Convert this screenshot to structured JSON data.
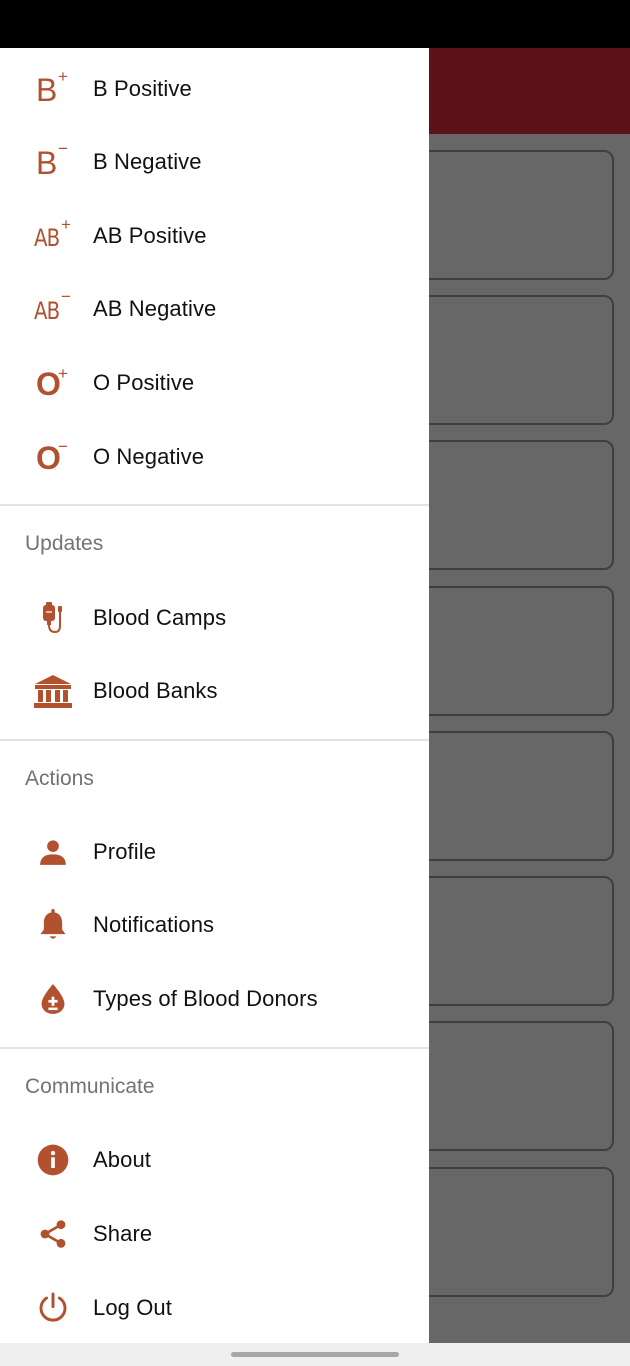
{
  "drawer": {
    "blood_groups": [
      {
        "letters": "B",
        "sign": "+",
        "label": "B Positive",
        "icon": "b-positive-icon"
      },
      {
        "letters": "B",
        "sign": "−",
        "label": "B Negative",
        "icon": "b-negative-icon"
      },
      {
        "letters": "AB",
        "sign": "+",
        "label": "AB Positive",
        "icon": "ab-positive-icon"
      },
      {
        "letters": "AB",
        "sign": "−",
        "label": "AB Negative",
        "icon": "ab-negative-icon"
      },
      {
        "letters": "O",
        "sign": "+",
        "label": "O Positive",
        "icon": "o-positive-icon"
      },
      {
        "letters": "O",
        "sign": "−",
        "label": "O Negative",
        "icon": "o-negative-icon"
      }
    ],
    "updates": {
      "header": "Updates",
      "items": [
        {
          "label": "Blood Camps",
          "icon": "blood-bag-icon"
        },
        {
          "label": "Blood Banks",
          "icon": "bank-building-icon"
        }
      ]
    },
    "actions": {
      "header": "Actions",
      "items": [
        {
          "label": "Profile",
          "icon": "person-icon"
        },
        {
          "label": "Notifications",
          "icon": "bell-icon"
        },
        {
          "label": "Types of Blood Donors",
          "icon": "blood-drop-icon"
        }
      ]
    },
    "communicate": {
      "header": "Communicate",
      "items": [
        {
          "label": "About",
          "icon": "info-icon"
        },
        {
          "label": "Share",
          "icon": "share-icon"
        },
        {
          "label": "Log Out",
          "icon": "power-icon"
        }
      ]
    }
  },
  "colors": {
    "accent": "#b1512e",
    "app_bar": "#5c1218",
    "scrim": "#676767",
    "section_header": "#737373"
  }
}
